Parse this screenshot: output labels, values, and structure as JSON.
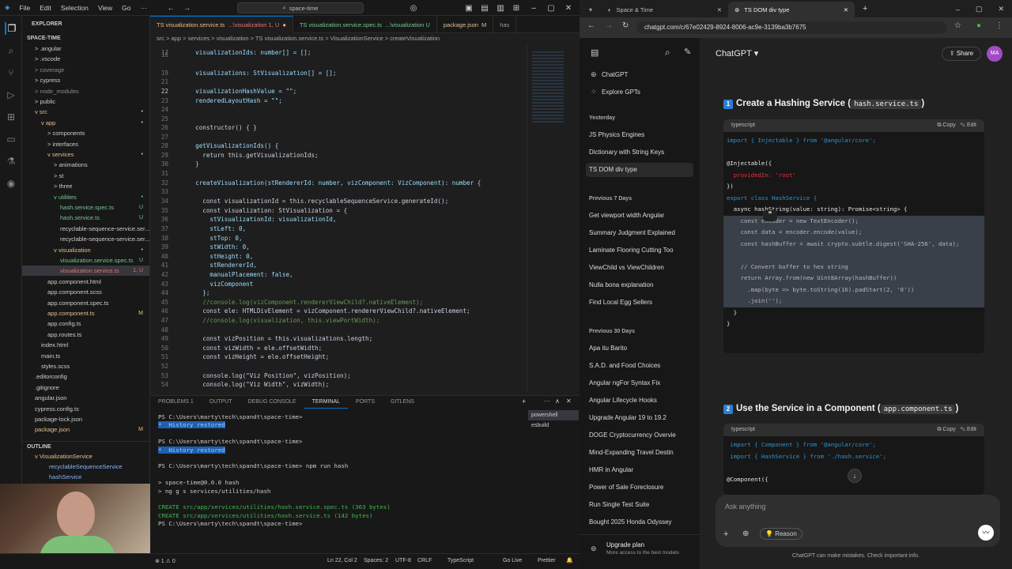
{
  "vscode": {
    "menu": [
      "File",
      "Edit",
      "Selection",
      "View",
      "Go"
    ],
    "search": "space-time",
    "explorer_title": "EXPLORER",
    "project": "SPACE-TIME",
    "tree": [
      {
        "label": "> .angular",
        "indent": 1,
        "badge": "",
        "color": "#ccc"
      },
      {
        "label": "> .vscode",
        "indent": 1,
        "badge": "",
        "color": "#ccc"
      },
      {
        "label": "> coverage",
        "indent": 1,
        "badge": "",
        "color": "#8b8b8b"
      },
      {
        "label": "> cypress",
        "indent": 1,
        "badge": "",
        "color": "#ccc"
      },
      {
        "label": "> node_modules",
        "indent": 1,
        "badge": "",
        "color": "#8b8b8b"
      },
      {
        "label": "> public",
        "indent": 1,
        "badge": "",
        "color": "#ccc"
      },
      {
        "label": "v src",
        "indent": 1,
        "badge": "•",
        "color": "#e2c08d"
      },
      {
        "label": "v app",
        "indent": 2,
        "badge": "•",
        "color": "#e2c08d"
      },
      {
        "label": "> components",
        "indent": 3,
        "badge": "",
        "color": "#ccc"
      },
      {
        "label": "> interfaces",
        "indent": 3,
        "badge": "",
        "color": "#ccc"
      },
      {
        "label": "v services",
        "indent": 3,
        "badge": "•",
        "color": "#e2c08d"
      },
      {
        "label": "> animations",
        "indent": 4,
        "badge": "",
        "color": "#ccc"
      },
      {
        "label": "> st",
        "indent": 4,
        "badge": "",
        "color": "#ccc"
      },
      {
        "label": "> three",
        "indent": 4,
        "badge": "",
        "color": "#ccc"
      },
      {
        "label": "v utilities",
        "indent": 4,
        "badge": "•",
        "color": "#73c991"
      },
      {
        "label": "hash.service.spec.ts",
        "indent": 5,
        "badge": "U",
        "color": "#73c991"
      },
      {
        "label": "hash.service.ts",
        "indent": 5,
        "badge": "U",
        "color": "#73c991"
      },
      {
        "label": "recyclable-sequence-service.ser...",
        "indent": 5,
        "badge": "",
        "color": "#ccc"
      },
      {
        "label": "recyclable-sequence-service.ser...",
        "indent": 5,
        "badge": "",
        "color": "#ccc"
      },
      {
        "label": "v visualization",
        "indent": 4,
        "badge": "•",
        "color": "#e2c08d"
      },
      {
        "label": "visualization.service.spec.ts",
        "indent": 5,
        "badge": "U",
        "color": "#73c991"
      },
      {
        "label": "visualization.service.ts",
        "indent": 5,
        "badge": "1, U",
        "color": "#e57373",
        "sel": true
      },
      {
        "label": "app.component.html",
        "indent": 3,
        "badge": "",
        "color": "#ccc"
      },
      {
        "label": "app.component.scss",
        "indent": 3,
        "badge": "",
        "color": "#ccc"
      },
      {
        "label": "app.component.spec.ts",
        "indent": 3,
        "badge": "",
        "color": "#ccc"
      },
      {
        "label": "app.component.ts",
        "indent": 3,
        "badge": "M",
        "color": "#e2c08d"
      },
      {
        "label": "app.config.ts",
        "indent": 3,
        "badge": "",
        "color": "#ccc"
      },
      {
        "label": "app.routes.ts",
        "indent": 3,
        "badge": "",
        "color": "#ccc"
      },
      {
        "label": "index.html",
        "indent": 2,
        "badge": "",
        "color": "#ccc"
      },
      {
        "label": "main.ts",
        "indent": 2,
        "badge": "",
        "color": "#ccc"
      },
      {
        "label": "styles.scss",
        "indent": 2,
        "badge": "",
        "color": "#ccc"
      },
      {
        "label": ".editorconfig",
        "indent": 1,
        "badge": "",
        "color": "#ccc"
      },
      {
        "label": ".gitignore",
        "indent": 1,
        "badge": "",
        "color": "#ccc"
      },
      {
        "label": "angular.json",
        "indent": 1,
        "badge": "",
        "color": "#ccc"
      },
      {
        "label": "cypress.config.ts",
        "indent": 1,
        "badge": "",
        "color": "#ccc"
      },
      {
        "label": "package-lock.json",
        "indent": 1,
        "badge": "",
        "color": "#ccc"
      },
      {
        "label": "package.json",
        "indent": 1,
        "badge": "M",
        "color": "#e2c08d"
      }
    ],
    "outline_title": "OUTLINE",
    "outline": [
      "v VisualizationService",
      "recyclableSequenceService",
      "hashService"
    ],
    "tabs": [
      {
        "label": "TS visualization.service.ts",
        "sub": "...\\visualization 1, U",
        "active": true
      },
      {
        "label": "TS visualization.service.spec.ts",
        "sub": "...\\visualization U",
        "active": false
      },
      {
        "label": "package.json",
        "sub": "M",
        "active": false
      },
      {
        "label": "has",
        "sub": "",
        "active": false
      }
    ],
    "breadcrumb": "src > app > services > visualization > TS visualization.service.ts > VisualizationService > createVisualization",
    "code": [
      {
        "n": "17",
        "t": "  visualizationIds: number[] = [];"
      },
      {
        "n": "18",
        "t": ""
      },
      {
        "n": "19",
        "t": "  visualizations: StVisualization[] = [];"
      },
      {
        "n": "21",
        "t": ""
      },
      {
        "n": "22",
        "t": "  visualizationHashValue = \"\";",
        "cur": true
      },
      {
        "n": "23",
        "t": "  renderedLayoutHash = \"\";"
      },
      {
        "n": "24",
        "t": ""
      },
      {
        "n": "25",
        "t": ""
      },
      {
        "n": "26",
        "t": "  constructor() { }"
      },
      {
        "n": "27",
        "t": ""
      },
      {
        "n": "28",
        "t": "  getVisualizationIds() {"
      },
      {
        "n": "29",
        "t": "    return this.getVisualizationIds;"
      },
      {
        "n": "30",
        "t": "  }"
      },
      {
        "n": "31",
        "t": ""
      },
      {
        "n": "32",
        "t": "  createVisualization(stRendererId: number, vizComponent: VizComponent): number {"
      },
      {
        "n": "33",
        "t": ""
      },
      {
        "n": "34",
        "t": "    const visualizationId = this.recyclableSequenceService.generateId();"
      },
      {
        "n": "35",
        "t": "    const visualization: StVisualization = {"
      },
      {
        "n": "36",
        "t": "      stVisualizationId: visualizationId,"
      },
      {
        "n": "37",
        "t": "      stLeft: 0,"
      },
      {
        "n": "38",
        "t": "      stTop: 0,"
      },
      {
        "n": "39",
        "t": "      stWidth: 0,"
      },
      {
        "n": "40",
        "t": "      stHeight: 0,"
      },
      {
        "n": "41",
        "t": "      stRendererId,"
      },
      {
        "n": "42",
        "t": "      manualPlacement: false,"
      },
      {
        "n": "43",
        "t": "      vizComponent"
      },
      {
        "n": "44",
        "t": "    };"
      },
      {
        "n": "45",
        "t": "    //console.log(vizComponent.rendererViewChild?.nativeElement);"
      },
      {
        "n": "46",
        "t": "    const ele: HTMLDivElement = vizComponent.rendererViewChild?.nativeElement;"
      },
      {
        "n": "47",
        "t": "    //console.log(visualization, this.viewPortWidth);"
      },
      {
        "n": "48",
        "t": ""
      },
      {
        "n": "49",
        "t": "    const vizPosition = this.visualizations.length;"
      },
      {
        "n": "50",
        "t": "    const vizWidth = ele.offsetWidth;"
      },
      {
        "n": "51",
        "t": "    const vizHeight = ele.offsetHeight;"
      },
      {
        "n": "52",
        "t": ""
      },
      {
        "n": "53",
        "t": "    console.log(\"Viz Position\", vizPosition);"
      },
      {
        "n": "54",
        "t": "    console.log(\"Viz Width\", vizWidth);"
      }
    ],
    "panel_tabs": [
      "PROBLEMS 1",
      "OUTPUT",
      "DEBUG CONSOLE",
      "TERMINAL",
      "PORTS",
      "GITLENS"
    ],
    "terminal": [
      {
        "t": "PS C:\\Users\\marty\\tech\\spandt\\space-time>"
      },
      {
        "t": "*  History restored",
        "hist": true
      },
      {
        "t": ""
      },
      {
        "t": "PS C:\\Users\\marty\\tech\\spandt\\space-time>"
      },
      {
        "t": "*  History restored",
        "hist": true
      },
      {
        "t": ""
      },
      {
        "t": "PS C:\\Users\\marty\\tech\\spandt\\space-time> npm run hash"
      },
      {
        "t": ""
      },
      {
        "t": "> space-time@0.0.0 hash"
      },
      {
        "t": "> ng g s services/utilities/hash"
      },
      {
        "t": ""
      },
      {
        "t": "CREATE src/app/services/utilities/hash.service.spec.ts (363 bytes)",
        "green": true
      },
      {
        "t": "CREATE src/app/services/utilities/hash.service.ts (142 bytes)",
        "green": true
      },
      {
        "t": "PS C:\\Users\\marty\\tech\\spandt\\space-time> "
      }
    ],
    "terminals": [
      "powershell",
      "esbuild"
    ],
    "status_left": "⊗ 1 ⚠ 0",
    "status_right": [
      "Ln 22, Col 2",
      "Spaces: 2",
      "UTF-8",
      "CRLF",
      "TypeScript",
      "Go Live",
      "Prettier"
    ]
  },
  "chrome": {
    "tabs": [
      {
        "label": "Space & Time",
        "active": false
      },
      {
        "label": "TS DOM div type",
        "active": true
      }
    ],
    "url": "chatgpt.com/c/67e02429-8924-8006-ac9e-3139ba3b7675",
    "sidebar_top": [
      "ChatGPT",
      "Explore GPTs"
    ],
    "groups": [
      {
        "head": "Yesterday",
        "items": [
          "JS Physics Engines",
          "Dictionary with String Keys",
          "TS DOM div type"
        ]
      },
      {
        "head": "Previous 7 Days",
        "items": [
          "Get viewport width Angular",
          "Summary Judgment Explained",
          "Laminate Flooring Cutting Too",
          "ViewChild vs ViewChildren",
          "Nulla bona explanation",
          "Find Local Egg Sellers"
        ]
      },
      {
        "head": "Previous 30 Days",
        "items": [
          "Apa itu Barito",
          "S.A.D. and Food Choices",
          "Angular ngFor Syntax Fix",
          "Angular Lifecycle Hooks",
          "Upgrade Angular 19 to 19.2",
          "DOGE Cryptocurrency Overvie",
          "Mind-Expanding Travel Destin",
          "HMR in Angular",
          "Power of Sale Foreclosure",
          "Run Single Test Suite",
          "Bought 2025 Honda Odyssey"
        ]
      }
    ],
    "upgrade": "Upgrade plan",
    "upgrade_sub": "More access to the best models",
    "header": "ChatGPT",
    "share": "Share",
    "avatar": "MA",
    "sec1_num": "1",
    "sec1_title": "Create a Hashing Service (",
    "sec1_code": "hash.service.ts",
    "sec1_close": ")",
    "lang": "typescript",
    "copy": "Copy",
    "edit": "Edit",
    "code1": [
      "import { Injectable } from '@angular/core';",
      "",
      "@Injectable({",
      "  providedIn: 'root'",
      "})",
      "export class HashService {",
      "  async hashString(value: string): Promise<string> {",
      "    const encoder = new TextEncoder();",
      "    const data = encoder.encode(value);",
      "    const hashBuffer = await crypto.subtle.digest('SHA-256', data);",
      "",
      "    // Convert buffer to hex string",
      "    return Array.from(new Uint8Array(hashBuffer))",
      "      .map(byte => byte.toString(16).padStart(2, '0'))",
      "      .join('');",
      "  }",
      "}"
    ],
    "sec2_num": "2",
    "sec2_title": "Use the Service in a Component (",
    "sec2_code": "app.component.ts",
    "sec2_close": ")",
    "code2": [
      " import { Component } from '@angular/core';",
      " import { HashService } from './hash.service';",
      "",
      "@Component({"
    ],
    "ask": "Ask anything",
    "reason": "Reason",
    "disclaimer": "ChatGPT can make mistakes. Check important info."
  }
}
